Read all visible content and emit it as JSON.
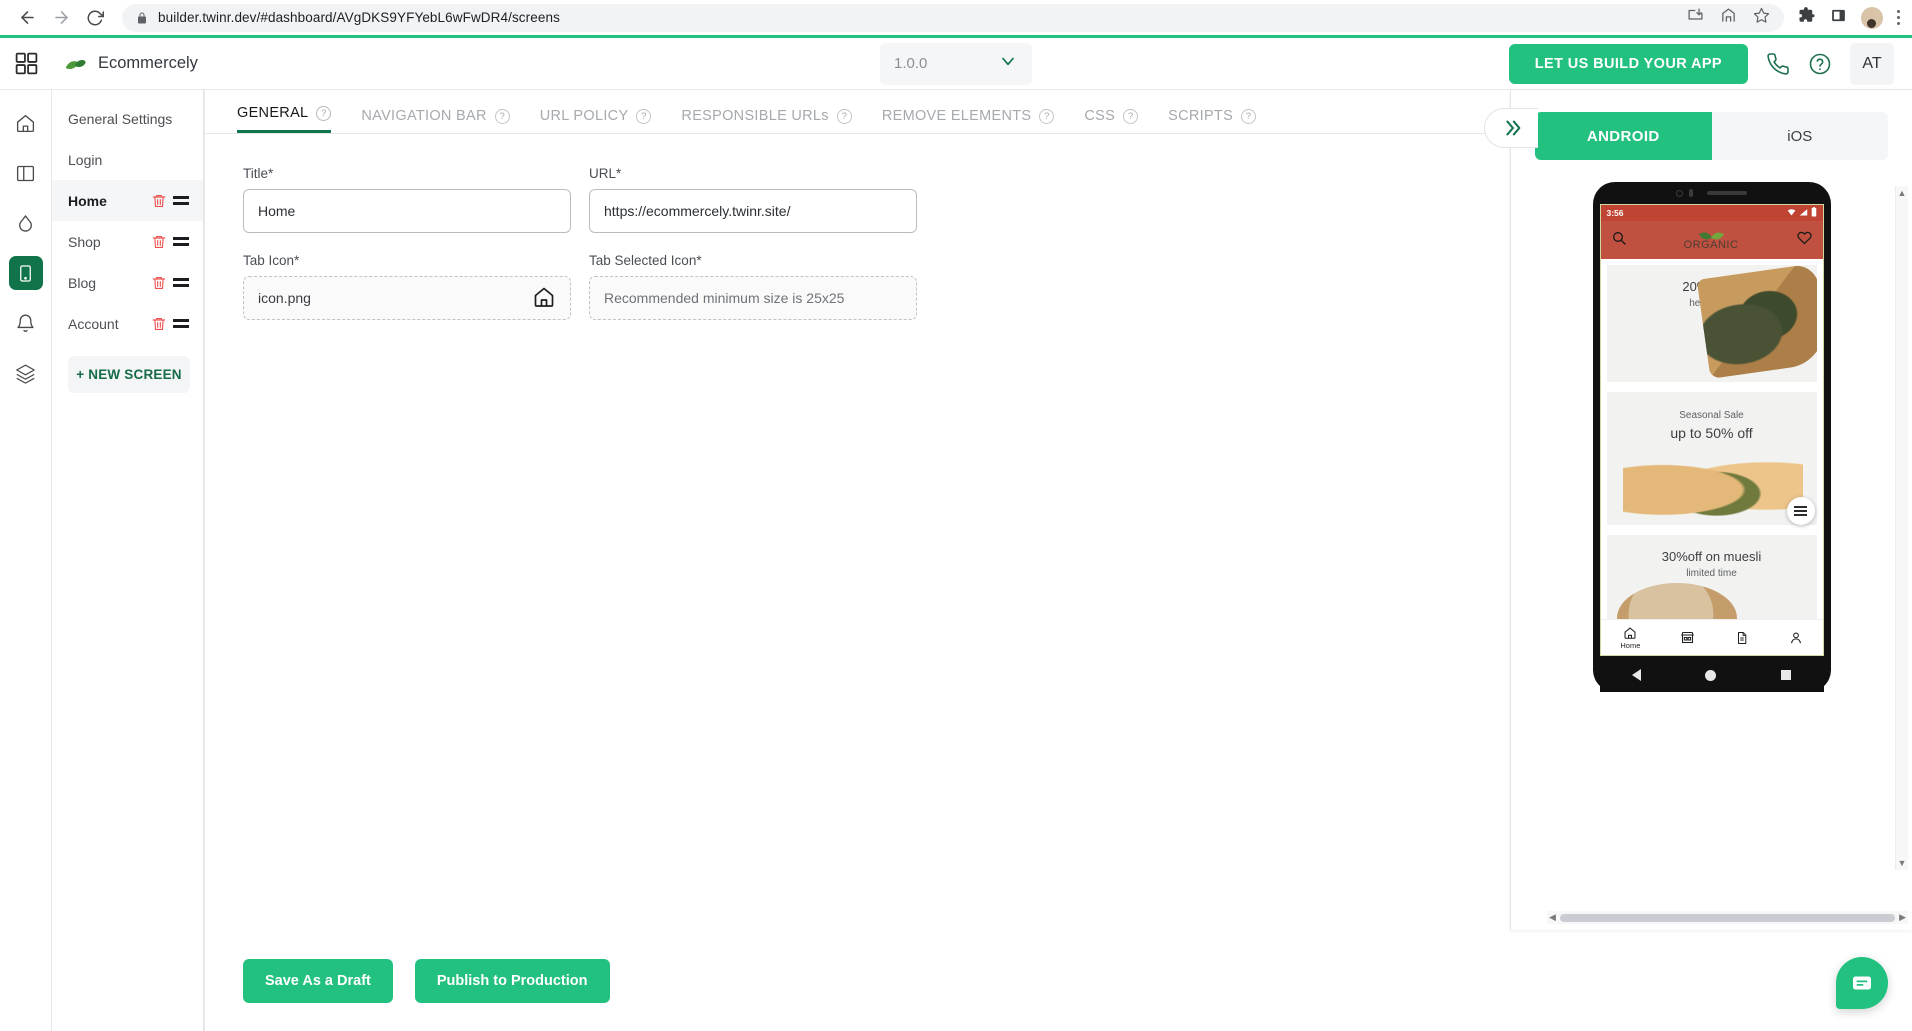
{
  "browser": {
    "url": "builder.twinr.dev/#dashboard/AVgDKS9YFYebL6wFwDR4/screens",
    "back_icon": "back-arrow-icon",
    "forward_icon": "forward-arrow-icon",
    "reload_icon": "reload-icon",
    "lock_icon": "lock-icon",
    "install_icon": "install-icon",
    "share_icon": "share-icon",
    "bookmark_icon": "star-icon",
    "extensions_icon": "puzzle-icon",
    "sidepanel_icon": "side-panel-icon",
    "menu_icon": "kebab-menu-icon"
  },
  "header": {
    "grid_icon": "grid-icon",
    "app_name": "Ecommercely",
    "version": "1.0.0",
    "build_button": "LET US BUILD YOUR APP",
    "phone_icon": "phone-icon",
    "help_icon": "help-icon",
    "user_initials": "AT"
  },
  "rail": [
    {
      "name": "home-icon"
    },
    {
      "name": "layout-icon"
    },
    {
      "name": "droplet-icon"
    },
    {
      "name": "mobile-icon",
      "active": true
    },
    {
      "name": "bell-icon"
    },
    {
      "name": "layers-icon"
    }
  ],
  "screens": {
    "items": [
      {
        "label": "General Settings",
        "deletable": false,
        "active": false
      },
      {
        "label": "Login",
        "deletable": false,
        "active": false
      },
      {
        "label": "Home",
        "deletable": true,
        "active": true
      },
      {
        "label": "Shop",
        "deletable": true,
        "active": false
      },
      {
        "label": "Blog",
        "deletable": true,
        "active": false
      },
      {
        "label": "Account",
        "deletable": true,
        "active": false
      }
    ],
    "new_screen_button": "+ NEW SCREEN"
  },
  "tabs": [
    {
      "label": "GENERAL",
      "active": true
    },
    {
      "label": "NAVIGATION BAR",
      "active": false
    },
    {
      "label": "URL POLICY",
      "active": false
    },
    {
      "label": "RESPONSIBLE URLs",
      "active": false
    },
    {
      "label": "REMOVE ELEMENTS",
      "active": false
    },
    {
      "label": "CSS",
      "active": false
    },
    {
      "label": "SCRIPTS",
      "active": false
    }
  ],
  "form": {
    "title_label": "Title*",
    "title_value": "Home",
    "url_label": "URL*",
    "url_value": "https://ecommercely.twinr.site/",
    "tab_icon_label": "Tab Icon*",
    "tab_icon_value": "icon.png",
    "tab_icon_glyph": "home-icon",
    "tab_selected_icon_label": "Tab Selected Icon*",
    "tab_selected_icon_placeholder": "Recommended minimum size is 25x25"
  },
  "actions": {
    "save_draft": "Save As a Draft",
    "publish": "Publish to Production"
  },
  "preview": {
    "collapse_icon": "double-chevron-right-icon",
    "platforms": [
      {
        "label": "ANDROID",
        "active": true
      },
      {
        "label": "iOS",
        "active": false
      }
    ],
    "phone": {
      "status_time": "3:56",
      "wifi_icon": "wifi-icon",
      "signal_icon": "signal-icon",
      "battery_icon": "battery-icon",
      "search_icon": "search-icon",
      "logo_text": "ORGANIC",
      "wishlist_icon": "heart-icon",
      "banners": [
        {
          "title": "20%off on",
          "subtitle": "herbal tea"
        },
        {
          "title": "up to 50% off",
          "subtitle": "Seasonal Sale"
        },
        {
          "title": "30%off on muesli",
          "subtitle": "limited time"
        }
      ],
      "fab_icon": "menu-lines-icon",
      "tabbar": [
        {
          "icon": "home-icon",
          "label": "Home"
        },
        {
          "icon": "shop-icon",
          "label": ""
        },
        {
          "icon": "document-icon",
          "label": ""
        },
        {
          "icon": "person-icon",
          "label": ""
        }
      ],
      "system_nav": [
        "back-triangle-icon",
        "home-circle-icon",
        "recents-square-icon"
      ]
    }
  },
  "chat": {
    "icon": "chat-bubble-icon"
  },
  "colors": {
    "brand_green": "#22c180",
    "dark_green": "#11734a",
    "danger_red": "#ef5350",
    "phone_header_red": "#c0503f"
  }
}
